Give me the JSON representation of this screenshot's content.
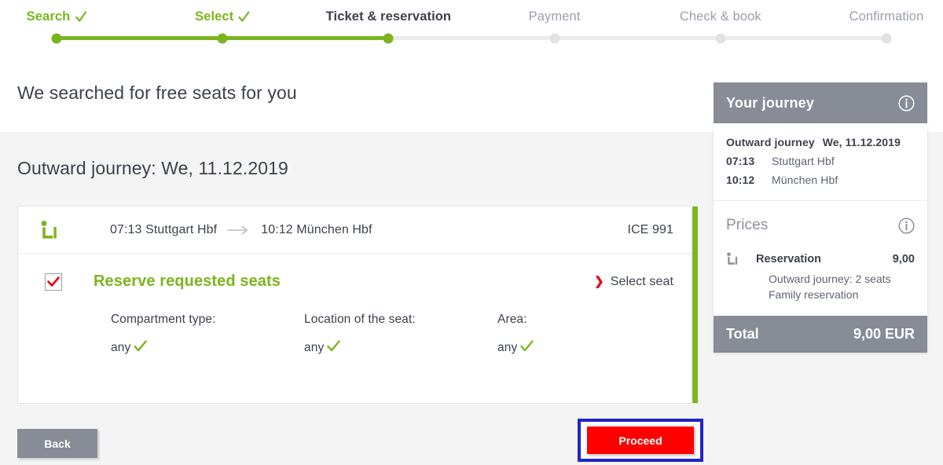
{
  "stepper": {
    "steps": [
      {
        "label": "Search",
        "state": "done",
        "check": true
      },
      {
        "label": "Select",
        "state": "done",
        "check": true
      },
      {
        "label": "Ticket & reservation",
        "state": "current",
        "check": false
      },
      {
        "label": "Payment",
        "state": "todo",
        "check": false
      },
      {
        "label": "Check & book",
        "state": "todo",
        "check": false
      },
      {
        "label": "Confirmation",
        "state": "todo",
        "check": false
      }
    ],
    "active_color": "#7ab51d",
    "inactive_color": "#e2e2e4"
  },
  "intro": {
    "heading": "We searched for free seats for you"
  },
  "main": {
    "section_title": "Outward journey: We, 11.12.2019",
    "connection": {
      "seat_icon": "seat-icon",
      "departure": "07:13 Stuttgart Hbf",
      "arrow_icon": "arrow-right-icon",
      "arrival": "10:12 München Hbf",
      "train": "ICE 991"
    },
    "reservation": {
      "checked": true,
      "title": "Reserve requested seats",
      "select_seat_label": "Select seat",
      "chevron_icon": "chevron-right-icon",
      "accent_color": "#7ab51d",
      "options": [
        {
          "label": "Compartment type:",
          "value": "any",
          "check": true
        },
        {
          "label": "Location of the seat:",
          "value": "any",
          "check": true
        },
        {
          "label": "Area:",
          "value": "any",
          "check": true
        }
      ]
    }
  },
  "buttons": {
    "back": "Back",
    "proceed": "Proceed",
    "proceed_color": "#ff0000",
    "highlight_color": "#2222cc"
  },
  "sidebar": {
    "header": {
      "title": "Your journey",
      "info_icon": "info-icon"
    },
    "journey": {
      "label": "Outward journey",
      "date": "We, 11.12.2019",
      "legs": [
        {
          "time": "07:13",
          "station": "Stuttgart Hbf"
        },
        {
          "time": "10:12",
          "station": "München Hbf"
        }
      ]
    },
    "prices": {
      "title": "Prices",
      "info_icon": "info-icon",
      "items": [
        {
          "icon": "seat-icon",
          "name": "Reservation",
          "amount": "9,00",
          "details": [
            "Outward journey: 2 seats",
            "Family reservation"
          ]
        }
      ]
    },
    "total": {
      "label": "Total",
      "amount": "9,00 EUR"
    }
  }
}
